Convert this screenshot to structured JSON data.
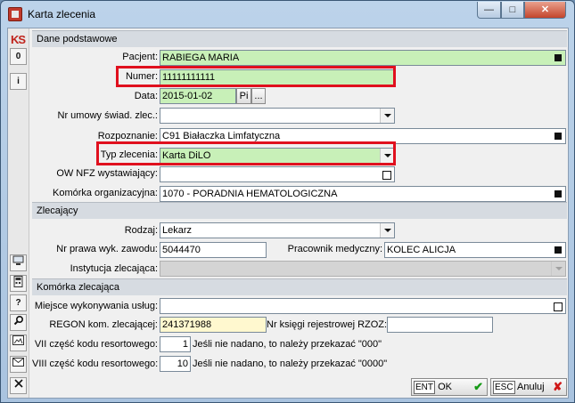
{
  "window": {
    "title": "Karta zlecenia",
    "min_glyph": "—",
    "max_glyph": "□",
    "close_glyph": "✕"
  },
  "leftbar": {
    "logo": "KS",
    "btn_zero": "0",
    "btn_info": "i",
    "btn_help": "?"
  },
  "dane_podstawowe": {
    "header": "Dane podstawowe",
    "pacjent_label": "Pacjent:",
    "pacjent_value": "RABIEGA MARIA",
    "numer_label": "Numer:",
    "numer_value": "11111111111",
    "data_label": "Data:",
    "data_value": "2015-01-02",
    "data_btn_pi": "Pi",
    "data_btn_more": "...",
    "nr_umowy_label": "Nr umowy świad. zlec.:",
    "nr_umowy_value": "",
    "rozpoznanie_label": "Rozpoznanie:",
    "rozpoznanie_value": "C91 Białaczka Limfatyczna",
    "typ_label": "Typ zlecenia:",
    "typ_value": "Karta DiLO",
    "ow_nfz_label": "OW NFZ wystawiający:",
    "ow_nfz_value": "",
    "komorka_label": "Komórka organizacyjna:",
    "komorka_value": "1070 - PORADNIA HEMATOLOGICZNA"
  },
  "zlecajacy": {
    "header": "Zlecający",
    "rodzaj_label": "Rodzaj:",
    "rodzaj_value": "Lekarz",
    "nr_prawa_label": "Nr prawa wyk. zawodu:",
    "nr_prawa_value": "5044470",
    "pracownik_label": "Pracownik medyczny:",
    "pracownik_value": "KOLEC ALICJA",
    "instytucja_label": "Instytucja zlecająca:",
    "instytucja_value": ""
  },
  "komorka_zlecajaca": {
    "header": "Komórka zlecająca",
    "miejsce_label": "Miejsce wykonywania usług:",
    "miejsce_value": "",
    "regon_label": "REGON kom. zlecającej:",
    "regon_value": "241371988",
    "ksiega_label": "Nr księgi rejestrowej RZOZ:",
    "ksiega_value": "",
    "vii_label": "VII część kodu resortowego:",
    "vii_value": "1",
    "vii_hint": "Jeśli nie nadano, to należy przekazać \"000\"",
    "viii_label": "VIII część kodu resortowego:",
    "viii_value": "10",
    "viii_hint": "Jeśli nie nadano, to należy przekazać \"0000\""
  },
  "footer": {
    "ok_key": "ENT",
    "ok_label": "OK",
    "cancel_key": "ESC",
    "cancel_label": "Anuluj"
  },
  "colors": {
    "highlight": "#e0101e",
    "green_field": "#c8f0b8",
    "yellow_field": "#fff8cf"
  }
}
